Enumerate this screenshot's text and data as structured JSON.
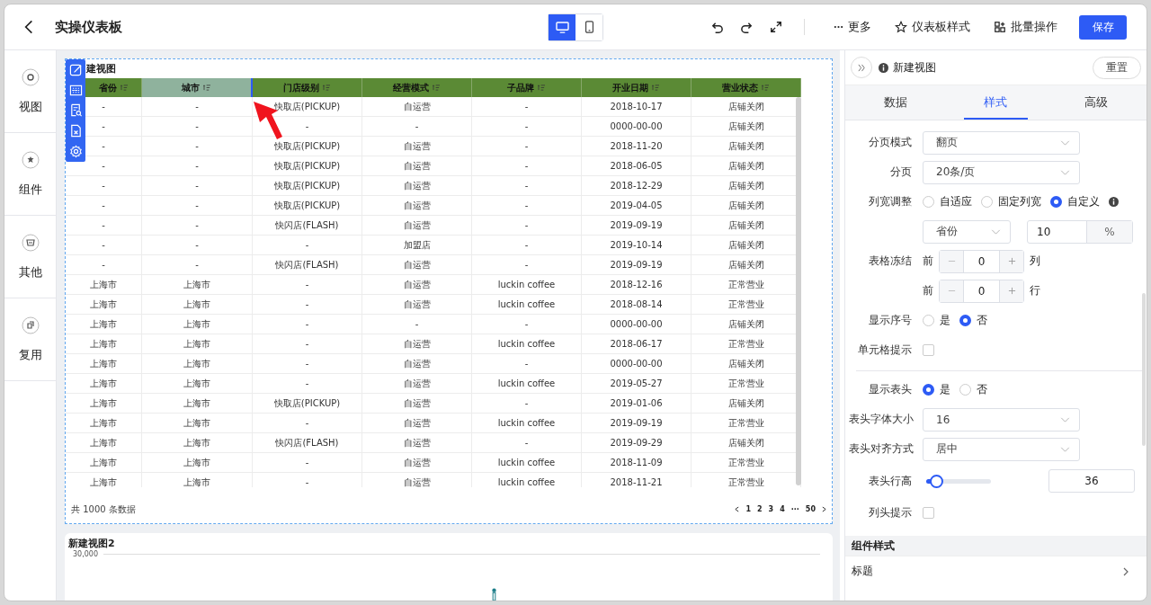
{
  "topbar": {
    "title": "实操仪表板",
    "devices": [
      {
        "kind": "desktop",
        "selected": true
      },
      {
        "kind": "mobile",
        "selected": false
      }
    ],
    "more": "更多",
    "actions": [
      {
        "kind": "style",
        "label": "仪表板样式"
      },
      {
        "kind": "batch",
        "label": "批量操作"
      }
    ],
    "save": "保存"
  },
  "rail": [
    {
      "kind": "view",
      "label": "视图"
    },
    {
      "kind": "widget",
      "label": "组件"
    },
    {
      "kind": "other",
      "label": "其他"
    },
    {
      "kind": "reuse",
      "label": "复用"
    }
  ],
  "table_view": {
    "title": "建视图",
    "columns": [
      {
        "label": "省份",
        "selected": false
      },
      {
        "label": "城市",
        "selected": true
      },
      {
        "label": "门店级别",
        "selected": false
      },
      {
        "label": "经营模式",
        "selected": false
      },
      {
        "label": "子品牌",
        "selected": false
      },
      {
        "label": "开业日期",
        "selected": false
      },
      {
        "label": "营业状态",
        "selected": false
      }
    ],
    "rows": [
      [
        "-",
        "-",
        "快取店(PICKUP)",
        "自运营",
        "-",
        "2018-10-17",
        "店铺关闭"
      ],
      [
        "-",
        "-",
        "-",
        "-",
        "-",
        "0000-00-00",
        "店铺关闭"
      ],
      [
        "-",
        "-",
        "快取店(PICKUP)",
        "自运营",
        "-",
        "2018-11-20",
        "店铺关闭"
      ],
      [
        "-",
        "-",
        "快取店(PICKUP)",
        "自运营",
        "-",
        "2018-06-05",
        "店铺关闭"
      ],
      [
        "-",
        "-",
        "快取店(PICKUP)",
        "自运营",
        "-",
        "2018-12-29",
        "店铺关闭"
      ],
      [
        "-",
        "-",
        "快取店(PICKUP)",
        "自运营",
        "-",
        "2019-04-05",
        "店铺关闭"
      ],
      [
        "-",
        "-",
        "快闪店(FLASH)",
        "自运营",
        "-",
        "2019-09-19",
        "店铺关闭"
      ],
      [
        "-",
        "-",
        "-",
        "加盟店",
        "-",
        "2019-10-14",
        "店铺关闭"
      ],
      [
        "-",
        "-",
        "快闪店(FLASH)",
        "自运营",
        "-",
        "2019-09-19",
        "店铺关闭"
      ],
      [
        "上海市",
        "上海市",
        "-",
        "自运营",
        "luckin coffee",
        "2018-12-16",
        "正常营业"
      ],
      [
        "上海市",
        "上海市",
        "-",
        "自运营",
        "luckin coffee",
        "2018-08-14",
        "正常营业"
      ],
      [
        "上海市",
        "上海市",
        "-",
        "-",
        "-",
        "0000-00-00",
        "店铺关闭"
      ],
      [
        "上海市",
        "上海市",
        "-",
        "自运营",
        "luckin coffee",
        "2018-06-17",
        "正常营业"
      ],
      [
        "上海市",
        "上海市",
        "-",
        "自运营",
        "-",
        "0000-00-00",
        "店铺关闭"
      ],
      [
        "上海市",
        "上海市",
        "-",
        "自运营",
        "luckin coffee",
        "2019-05-27",
        "正常营业"
      ],
      [
        "上海市",
        "上海市",
        "快取店(PICKUP)",
        "自运营",
        "-",
        "2019-01-06",
        "店铺关闭"
      ],
      [
        "上海市",
        "上海市",
        "-",
        "自运营",
        "luckin coffee",
        "2019-09-19",
        "正常营业"
      ],
      [
        "上海市",
        "上海市",
        "快闪店(FLASH)",
        "自运营",
        "-",
        "2019-09-29",
        "店铺关闭"
      ],
      [
        "上海市",
        "上海市",
        "-",
        "自运营",
        "luckin coffee",
        "2018-11-09",
        "正常营业"
      ],
      [
        "上海市",
        "上海市",
        "-",
        "自运营",
        "luckin coffee",
        "2018-11-21",
        "正常营业"
      ]
    ],
    "total": "共 1000 条数据",
    "pages": [
      "1",
      "2",
      "3",
      "4",
      "···",
      "50"
    ]
  },
  "chart_view": {
    "title": "新建视图2",
    "y_label": "30,000"
  },
  "panel": {
    "title": "新建视图",
    "reset": "重置",
    "tabs": [
      {
        "label": "数据",
        "selected": false
      },
      {
        "label": "样式",
        "selected": true
      },
      {
        "label": "高级",
        "selected": false
      }
    ],
    "fields": [
      {
        "kind": "select",
        "label": "分页模式",
        "value": "翻页"
      },
      {
        "kind": "select",
        "label": "分页",
        "value": "20条/页"
      },
      {
        "kind": "radio",
        "label": "列宽调整",
        "info": true,
        "options": [
          {
            "label": "自适应",
            "selected": false
          },
          {
            "label": "固定列宽",
            "selected": false
          },
          {
            "label": "自定义",
            "selected": true
          }
        ]
      },
      {
        "kind": "width",
        "column": "省份",
        "value": "10",
        "unit": "%"
      },
      {
        "kind": "stepper",
        "label": "表格冻结",
        "prefix": "前",
        "value": "0",
        "suffix": "列"
      },
      {
        "kind": "stepper",
        "prefix": "前",
        "value": "0",
        "suffix": "行"
      },
      {
        "kind": "radio",
        "label": "显示序号",
        "options": [
          {
            "label": "是",
            "selected": false
          },
          {
            "label": "否",
            "selected": true
          }
        ]
      },
      {
        "kind": "check",
        "label": "单元格提示",
        "checked": false
      },
      {
        "kind": "divider"
      },
      {
        "kind": "radio",
        "label": "显示表头",
        "options": [
          {
            "label": "是",
            "selected": true
          },
          {
            "label": "否",
            "selected": false
          }
        ]
      },
      {
        "kind": "select",
        "label": "表头字体大小",
        "value": "16"
      },
      {
        "kind": "select",
        "label": "表头对齐方式",
        "value": "居中"
      },
      {
        "kind": "slider",
        "label": "表头行高",
        "level": 0.15,
        "value": "36"
      },
      {
        "kind": "check",
        "label": "列头提示",
        "checked": false
      }
    ],
    "section": "组件样式",
    "items": [
      {
        "label": "标题"
      }
    ]
  }
}
